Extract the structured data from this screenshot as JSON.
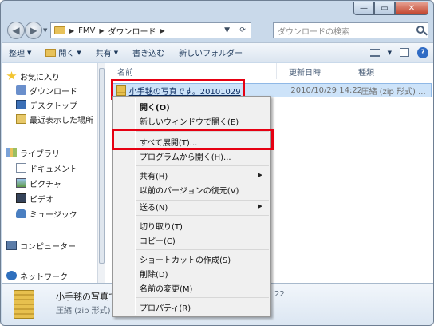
{
  "window": {
    "caption_minimize": "—",
    "caption_maximize": "▭",
    "caption_close": "✕"
  },
  "address": {
    "back": "◀",
    "forward": "▶",
    "path": [
      "FMV",
      "ダウンロード"
    ],
    "refresh_icon": "⟳",
    "search_placeholder": "ダウンロードの検索"
  },
  "toolbar": {
    "organize": "整理",
    "open": "開く",
    "share": "共有",
    "burn": "書き込む",
    "new_folder": "新しいフォルダー"
  },
  "nav": {
    "favorites": "お気に入り",
    "downloads": "ダウンロード",
    "desktop": "デスクトップ",
    "recent": "最近表示した場所",
    "libraries": "ライブラリ",
    "documents": "ドキュメント",
    "pictures": "ピクチャ",
    "videos": "ビデオ",
    "music": "ミュージック",
    "computer": "コンピューター",
    "network": "ネットワーク"
  },
  "columns": {
    "name": "名前",
    "date": "更新日時",
    "type": "種類"
  },
  "file": {
    "name": "小手毬の写真です。20101029",
    "date": "2010/10/29 14:22",
    "type": "圧縮 (zip 形式) ..."
  },
  "menu": {
    "open": "開く(O)",
    "open_new_window": "新しいウィンドウで開く(E)",
    "extract_all": "すべて展開(T)...",
    "open_with": "プログラムから開く(H)...",
    "share": "共有(H)",
    "restore_previous": "以前のバージョンの復元(V)",
    "send_to": "送る(N)",
    "cut": "切り取り(T)",
    "copy": "コピー(C)",
    "create_shortcut": "ショートカットの作成(S)",
    "delete": "削除(D)",
    "rename": "名前の変更(M)",
    "properties": "プロパティ(R)"
  },
  "details": {
    "name": "小手毬の写真です",
    "type": "圧縮 (zip 形式) フ",
    "date_fragment": "22"
  },
  "colors": {
    "highlight": "#e60012",
    "selection": "#cde3f9"
  }
}
